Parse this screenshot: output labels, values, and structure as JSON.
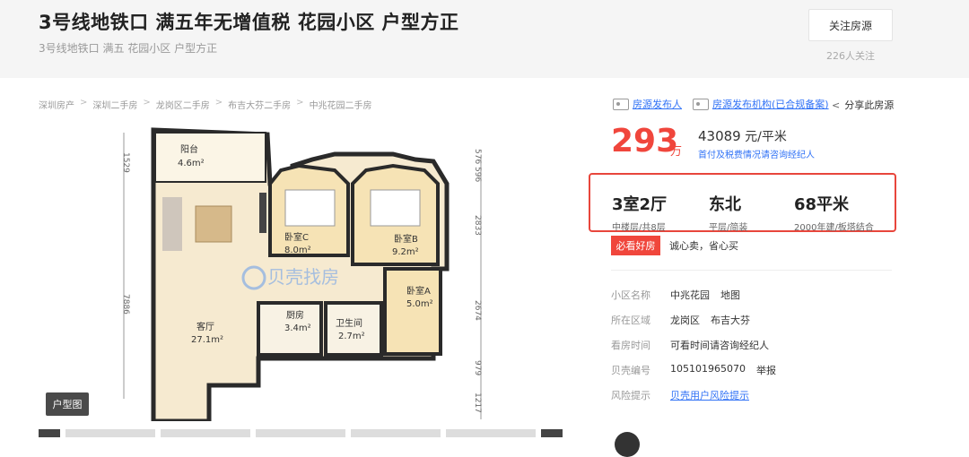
{
  "header": {
    "title": "3号线地铁口 满五年无增值税 花园小区 户型方正",
    "subtitle": "3号线地铁口 满五 花园小区 户型方正",
    "follow_label": "关注房源",
    "follow_count": "226人关注"
  },
  "breadcrumb": [
    "深圳房产",
    "深圳二手房",
    "龙岗区二手房",
    "布吉大芬二手房",
    "中兆花园二手房"
  ],
  "floorplan": {
    "tag": "户型图",
    "watermark": "贝壳找房",
    "rooms": [
      {
        "name": "阳台",
        "area": "4.6m²"
      },
      {
        "name": "卧室C",
        "area": "8.0m²"
      },
      {
        "name": "卧室B",
        "area": "9.2m²"
      },
      {
        "name": "卧室A",
        "area": "5.0m²"
      },
      {
        "name": "客厅",
        "area": "27.1m²"
      },
      {
        "name": "厨房",
        "area": "3.4m²"
      },
      {
        "name": "卫生间",
        "area": "2.7m²"
      }
    ],
    "dims_left": [
      "1529",
      "7886"
    ],
    "dims_right": [
      "576",
      "596",
      "2833",
      "2674",
      "979",
      "1217"
    ]
  },
  "meta": {
    "publisher": "房源发布人",
    "agency": "房源发布机构(已合规备案)",
    "share": "分享此房源"
  },
  "price": {
    "total": "293",
    "total_unit": "万",
    "unit_price": "43089",
    "unit_price_unit": "元/平米",
    "tax_note": "首付及税费情况请咨询经纪人"
  },
  "info": [
    {
      "main": "3室2厅",
      "sub": "中楼层/共8层"
    },
    {
      "main": "东北",
      "sub": "平层/简装"
    },
    {
      "main": "68平米",
      "sub": "2000年建/板塔结合"
    }
  ],
  "must_see": {
    "badge": "必看好房",
    "text": "诚心卖，省心买"
  },
  "details": {
    "community_label": "小区名称",
    "community": "中兆花园",
    "map": "地图",
    "area_label": "所在区域",
    "district": "龙岗区",
    "subarea": "布吉大芬",
    "visit_label": "看房时间",
    "visit": "可看时间请咨询经纪人",
    "id_label": "贝壳编号",
    "id": "105101965070",
    "report": "举报",
    "risk_label": "风险提示",
    "risk": "贝壳用户风险提示"
  },
  "colors": {
    "accent": "#f0463c",
    "link": "#3072f6",
    "room": "#f6e3b5",
    "living": "#f6ead0"
  }
}
